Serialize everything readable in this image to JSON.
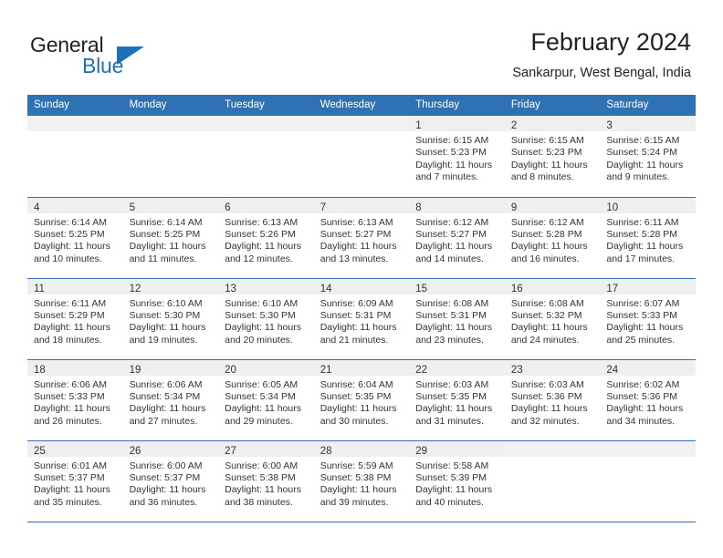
{
  "logo": {
    "word_one": "General",
    "word_two": "Blue",
    "triangle_icon": "triangle-icon",
    "accent_color": "#1b72b8"
  },
  "header": {
    "title": "February 2024",
    "subtitle": "Sankarpur, West Bengal, India"
  },
  "theme": {
    "header_blue": "#2f72b4",
    "daynum_band": "#efefef",
    "text": "#333333"
  },
  "weekday_headers": [
    "Sunday",
    "Monday",
    "Tuesday",
    "Wednesday",
    "Thursday",
    "Friday",
    "Saturday"
  ],
  "weeks": [
    [
      {
        "day": "",
        "sunrise": "",
        "sunset": "",
        "daylight_1": "",
        "daylight_2": ""
      },
      {
        "day": "",
        "sunrise": "",
        "sunset": "",
        "daylight_1": "",
        "daylight_2": ""
      },
      {
        "day": "",
        "sunrise": "",
        "sunset": "",
        "daylight_1": "",
        "daylight_2": ""
      },
      {
        "day": "",
        "sunrise": "",
        "sunset": "",
        "daylight_1": "",
        "daylight_2": ""
      },
      {
        "day": "1",
        "sunrise": "Sunrise: 6:15 AM",
        "sunset": "Sunset: 5:23 PM",
        "daylight_1": "Daylight: 11 hours",
        "daylight_2": "and 7 minutes."
      },
      {
        "day": "2",
        "sunrise": "Sunrise: 6:15 AM",
        "sunset": "Sunset: 5:23 PM",
        "daylight_1": "Daylight: 11 hours",
        "daylight_2": "and 8 minutes."
      },
      {
        "day": "3",
        "sunrise": "Sunrise: 6:15 AM",
        "sunset": "Sunset: 5:24 PM",
        "daylight_1": "Daylight: 11 hours",
        "daylight_2": "and 9 minutes."
      }
    ],
    [
      {
        "day": "4",
        "sunrise": "Sunrise: 6:14 AM",
        "sunset": "Sunset: 5:25 PM",
        "daylight_1": "Daylight: 11 hours",
        "daylight_2": "and 10 minutes."
      },
      {
        "day": "5",
        "sunrise": "Sunrise: 6:14 AM",
        "sunset": "Sunset: 5:25 PM",
        "daylight_1": "Daylight: 11 hours",
        "daylight_2": "and 11 minutes."
      },
      {
        "day": "6",
        "sunrise": "Sunrise: 6:13 AM",
        "sunset": "Sunset: 5:26 PM",
        "daylight_1": "Daylight: 11 hours",
        "daylight_2": "and 12 minutes."
      },
      {
        "day": "7",
        "sunrise": "Sunrise: 6:13 AM",
        "sunset": "Sunset: 5:27 PM",
        "daylight_1": "Daylight: 11 hours",
        "daylight_2": "and 13 minutes."
      },
      {
        "day": "8",
        "sunrise": "Sunrise: 6:12 AM",
        "sunset": "Sunset: 5:27 PM",
        "daylight_1": "Daylight: 11 hours",
        "daylight_2": "and 14 minutes."
      },
      {
        "day": "9",
        "sunrise": "Sunrise: 6:12 AM",
        "sunset": "Sunset: 5:28 PM",
        "daylight_1": "Daylight: 11 hours",
        "daylight_2": "and 16 minutes."
      },
      {
        "day": "10",
        "sunrise": "Sunrise: 6:11 AM",
        "sunset": "Sunset: 5:28 PM",
        "daylight_1": "Daylight: 11 hours",
        "daylight_2": "and 17 minutes."
      }
    ],
    [
      {
        "day": "11",
        "sunrise": "Sunrise: 6:11 AM",
        "sunset": "Sunset: 5:29 PM",
        "daylight_1": "Daylight: 11 hours",
        "daylight_2": "and 18 minutes."
      },
      {
        "day": "12",
        "sunrise": "Sunrise: 6:10 AM",
        "sunset": "Sunset: 5:30 PM",
        "daylight_1": "Daylight: 11 hours",
        "daylight_2": "and 19 minutes."
      },
      {
        "day": "13",
        "sunrise": "Sunrise: 6:10 AM",
        "sunset": "Sunset: 5:30 PM",
        "daylight_1": "Daylight: 11 hours",
        "daylight_2": "and 20 minutes."
      },
      {
        "day": "14",
        "sunrise": "Sunrise: 6:09 AM",
        "sunset": "Sunset: 5:31 PM",
        "daylight_1": "Daylight: 11 hours",
        "daylight_2": "and 21 minutes."
      },
      {
        "day": "15",
        "sunrise": "Sunrise: 6:08 AM",
        "sunset": "Sunset: 5:31 PM",
        "daylight_1": "Daylight: 11 hours",
        "daylight_2": "and 23 minutes."
      },
      {
        "day": "16",
        "sunrise": "Sunrise: 6:08 AM",
        "sunset": "Sunset: 5:32 PM",
        "daylight_1": "Daylight: 11 hours",
        "daylight_2": "and 24 minutes."
      },
      {
        "day": "17",
        "sunrise": "Sunrise: 6:07 AM",
        "sunset": "Sunset: 5:33 PM",
        "daylight_1": "Daylight: 11 hours",
        "daylight_2": "and 25 minutes."
      }
    ],
    [
      {
        "day": "18",
        "sunrise": "Sunrise: 6:06 AM",
        "sunset": "Sunset: 5:33 PM",
        "daylight_1": "Daylight: 11 hours",
        "daylight_2": "and 26 minutes."
      },
      {
        "day": "19",
        "sunrise": "Sunrise: 6:06 AM",
        "sunset": "Sunset: 5:34 PM",
        "daylight_1": "Daylight: 11 hours",
        "daylight_2": "and 27 minutes."
      },
      {
        "day": "20",
        "sunrise": "Sunrise: 6:05 AM",
        "sunset": "Sunset: 5:34 PM",
        "daylight_1": "Daylight: 11 hours",
        "daylight_2": "and 29 minutes."
      },
      {
        "day": "21",
        "sunrise": "Sunrise: 6:04 AM",
        "sunset": "Sunset: 5:35 PM",
        "daylight_1": "Daylight: 11 hours",
        "daylight_2": "and 30 minutes."
      },
      {
        "day": "22",
        "sunrise": "Sunrise: 6:03 AM",
        "sunset": "Sunset: 5:35 PM",
        "daylight_1": "Daylight: 11 hours",
        "daylight_2": "and 31 minutes."
      },
      {
        "day": "23",
        "sunrise": "Sunrise: 6:03 AM",
        "sunset": "Sunset: 5:36 PM",
        "daylight_1": "Daylight: 11 hours",
        "daylight_2": "and 32 minutes."
      },
      {
        "day": "24",
        "sunrise": "Sunrise: 6:02 AM",
        "sunset": "Sunset: 5:36 PM",
        "daylight_1": "Daylight: 11 hours",
        "daylight_2": "and 34 minutes."
      }
    ],
    [
      {
        "day": "25",
        "sunrise": "Sunrise: 6:01 AM",
        "sunset": "Sunset: 5:37 PM",
        "daylight_1": "Daylight: 11 hours",
        "daylight_2": "and 35 minutes."
      },
      {
        "day": "26",
        "sunrise": "Sunrise: 6:00 AM",
        "sunset": "Sunset: 5:37 PM",
        "daylight_1": "Daylight: 11 hours",
        "daylight_2": "and 36 minutes."
      },
      {
        "day": "27",
        "sunrise": "Sunrise: 6:00 AM",
        "sunset": "Sunset: 5:38 PM",
        "daylight_1": "Daylight: 11 hours",
        "daylight_2": "and 38 minutes."
      },
      {
        "day": "28",
        "sunrise": "Sunrise: 5:59 AM",
        "sunset": "Sunset: 5:38 PM",
        "daylight_1": "Daylight: 11 hours",
        "daylight_2": "and 39 minutes."
      },
      {
        "day": "29",
        "sunrise": "Sunrise: 5:58 AM",
        "sunset": "Sunset: 5:39 PM",
        "daylight_1": "Daylight: 11 hours",
        "daylight_2": "and 40 minutes."
      },
      {
        "day": "",
        "sunrise": "",
        "sunset": "",
        "daylight_1": "",
        "daylight_2": ""
      },
      {
        "day": "",
        "sunrise": "",
        "sunset": "",
        "daylight_1": "",
        "daylight_2": ""
      }
    ]
  ]
}
